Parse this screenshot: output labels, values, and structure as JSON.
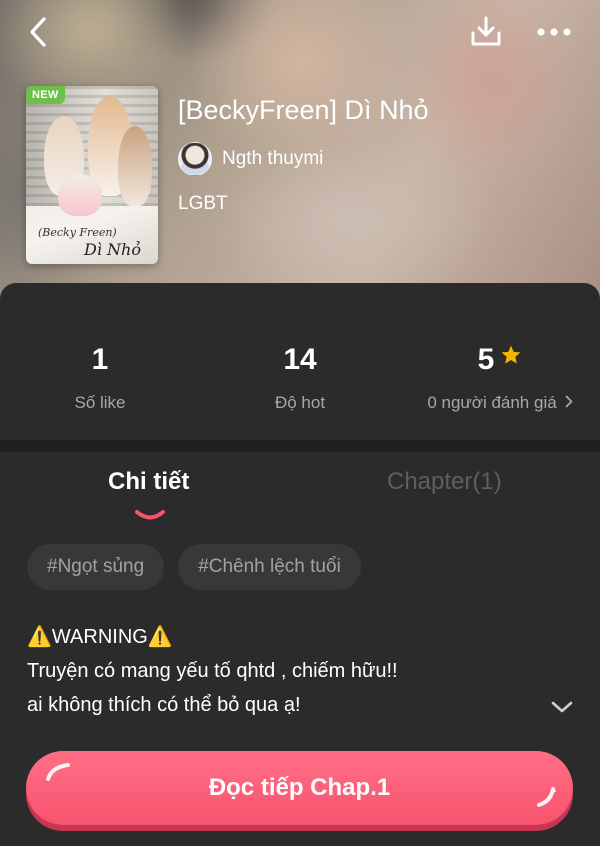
{
  "header": {
    "badge": "NEW",
    "cover_script_small": "(Becky Freen)",
    "cover_script_large": "Dì Nhỏ",
    "title": "[BeckyFreen] Dì Nhỏ",
    "author": "Ngth thuymi",
    "genre": "LGBT"
  },
  "stats": {
    "likes_value": "1",
    "likes_label": "Số like",
    "hot_value": "14",
    "hot_label": "Độ hot",
    "rating_value": "5",
    "rating_label": "0 người đánh giá"
  },
  "tabs": {
    "details": "Chi tiết",
    "chapters": "Chapter(1)"
  },
  "tags": [
    "#Ngọt sủng",
    "#Chênh lệch tuổi"
  ],
  "description": {
    "line1": "⚠️WARNING⚠️",
    "line2": "Truyện có mang yếu tố qhtd , chiếm hữu!!",
    "line3": "ai không thích có thể bỏ qua ạ!"
  },
  "cta": {
    "label": "Đọc tiếp Chap.1"
  },
  "colors": {
    "accent": "#f7536e",
    "star": "#f5b400",
    "badge": "#6cc04a",
    "panel": "#2b2b2b"
  }
}
